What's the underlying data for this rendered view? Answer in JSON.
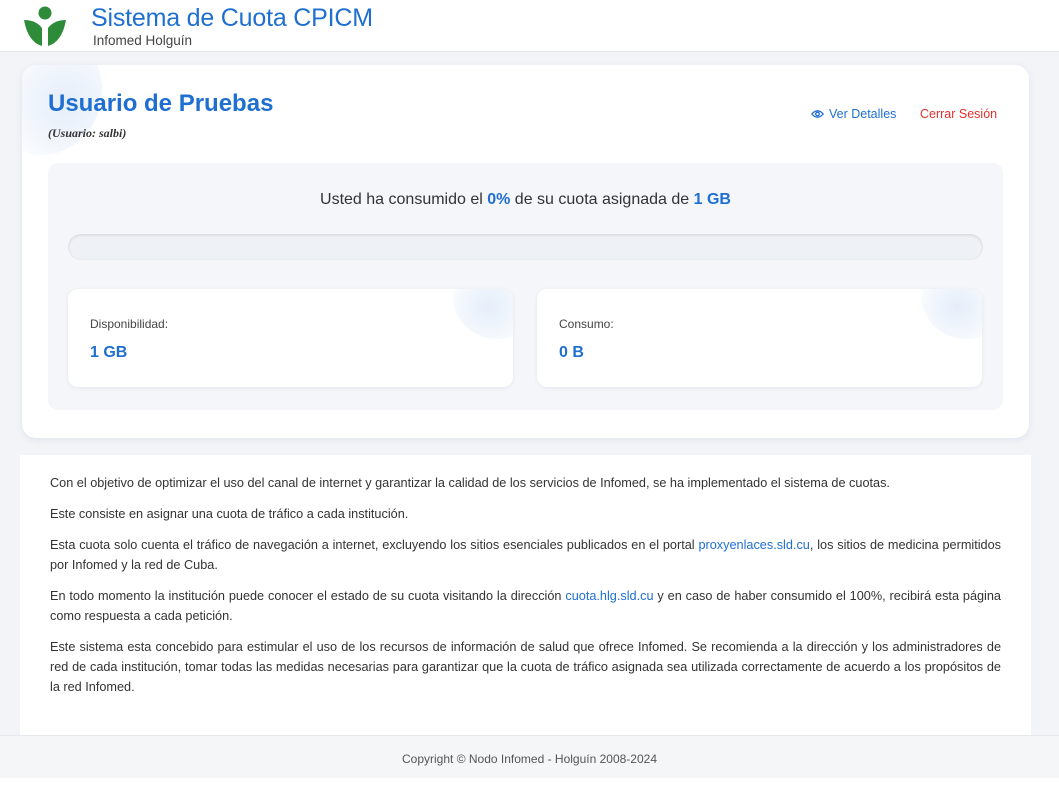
{
  "header": {
    "title": "Sistema de Cuota CPICM",
    "subtitle": "Infomed Holguín"
  },
  "user": {
    "name": "Usuario de Pruebas",
    "id_line": "(Usuario: salbi)"
  },
  "actions": {
    "details": "Ver Detalles",
    "logout": "Cerrar Sesión"
  },
  "usage": {
    "prefix": "Usted ha consumido el ",
    "percent_text": "0%",
    "middle": " de su cuota asignada de ",
    "quota": "1 GB",
    "progress_percent": 0
  },
  "stats": {
    "available_label": "Disponibilidad:",
    "available_value": "1 GB",
    "consumed_label": "Consumo:",
    "consumed_value": "0 B"
  },
  "info": {
    "p1": "Con el objetivo de optimizar el uso del canal de internet y garantizar la calidad de los servicios de Infomed, se ha implementado el sistema de cuotas.",
    "p2": "Este consiste en asignar una cuota de tráfico a cada institución.",
    "p3_a": "Esta cuota solo cuenta el tráfico de navegación a internet, excluyendo los sitios esenciales publicados en el portal ",
    "p3_link": "proxyenlaces.sld.cu",
    "p3_b": ", los sitios de medicina permitidos por Infomed y la red de Cuba.",
    "p4_a": "En todo momento la institución puede conocer el estado de su cuota visitando la dirección ",
    "p4_link": "cuota.hlg.sld.cu",
    "p4_b": " y en caso de haber consumido el 100%, recibirá esta página como respuesta a cada petición.",
    "p5": "Este sistema esta concebido para estimular el uso de los recursos de información de salud que ofrece Infomed. Se recomienda a la dirección y los administradores de red de cada institución, tomar todas las medidas necesarias para garantizar que la cuota de tráfico asignada sea utilizada correctamente de acuerdo a los propósitos de la red Infomed."
  },
  "footer": {
    "copyright": "Copyright © Nodo Infomed - Holguín 2008-2024"
  },
  "colors": {
    "brand": "#1f6fd1",
    "logo_green": "#2e8b3a",
    "logout": "#e0312f"
  },
  "icons": {
    "details": "eye-icon",
    "logo": "infomed-logo-icon"
  }
}
